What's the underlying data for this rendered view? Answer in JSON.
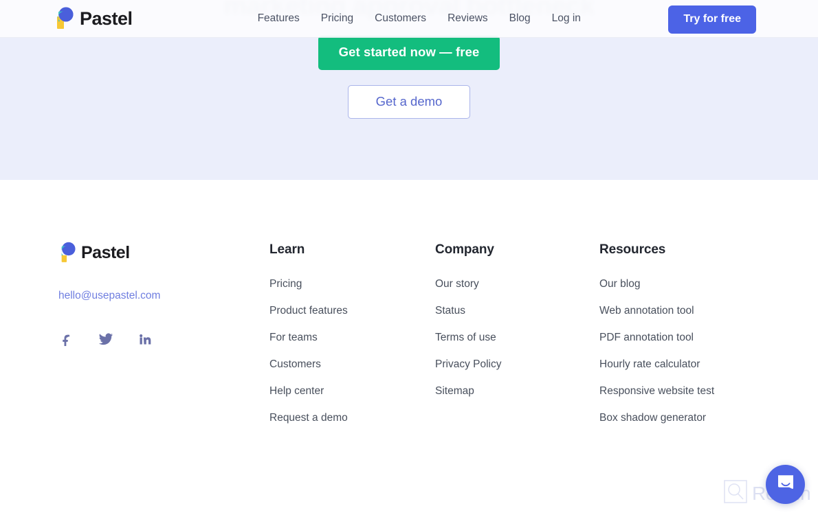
{
  "header": {
    "brand_name": "Pastel",
    "logo_icon": "pastel-logo-icon",
    "nav": [
      {
        "label": "Features"
      },
      {
        "label": "Pricing"
      },
      {
        "label": "Customers"
      },
      {
        "label": "Reviews"
      },
      {
        "label": "Blog"
      },
      {
        "label": "Log in"
      }
    ],
    "cta_label": "Try for free",
    "cta_color": "#4c63e6"
  },
  "hero": {
    "background_color": "#ebeefb",
    "obscured_headline": "marketing approval bottleneck",
    "primary_cta": "Get started now — free",
    "primary_cta_color": "#13bd7e",
    "secondary_cta": "Get a demo",
    "secondary_cta_border_color": "#aab4ea",
    "secondary_cta_text_color": "#5566cc"
  },
  "footer": {
    "brand_name": "Pastel",
    "logo_icon": "pastel-logo-icon",
    "email": "hello@usepastel.com",
    "email_color": "#6f7ee0",
    "social": [
      {
        "name": "facebook-icon",
        "glyph": "f"
      },
      {
        "name": "twitter-icon",
        "glyph": "twitter"
      },
      {
        "name": "linkedin-icon",
        "glyph": "in"
      }
    ],
    "columns": [
      {
        "heading": "Learn",
        "links": [
          {
            "label": "Pricing"
          },
          {
            "label": "Product features"
          },
          {
            "label": "For teams"
          },
          {
            "label": "Customers"
          },
          {
            "label": "Help center"
          },
          {
            "label": "Request a demo"
          }
        ]
      },
      {
        "heading": "Company",
        "links": [
          {
            "label": "Our story"
          },
          {
            "label": "Status"
          },
          {
            "label": "Terms of use"
          },
          {
            "label": "Privacy Policy"
          },
          {
            "label": "Sitemap"
          }
        ]
      },
      {
        "heading": "Resources",
        "links": [
          {
            "label": "Our blog"
          },
          {
            "label": "Web annotation tool"
          },
          {
            "label": "PDF annotation tool"
          },
          {
            "label": "Hourly rate calculator"
          },
          {
            "label": "Responsive website test"
          },
          {
            "label": "Box shadow generator"
          }
        ]
      }
    ]
  },
  "overlays": {
    "watermark_text": "Revain",
    "watermark_icon": "revain-magnifier-icon",
    "chat_launcher_icon": "intercom-chat-icon",
    "chat_launcher_color": "#4d64e4"
  }
}
